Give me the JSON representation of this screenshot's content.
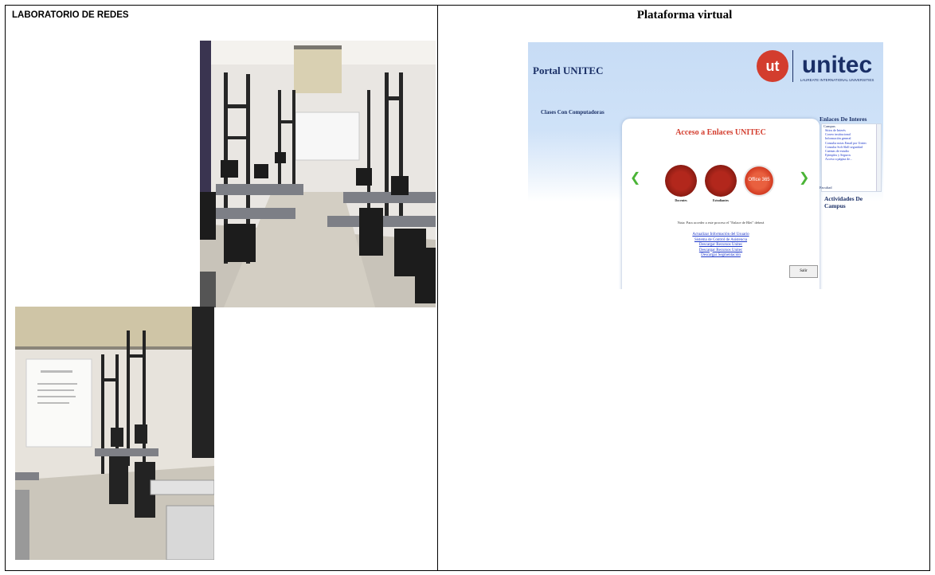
{
  "left_column": {
    "heading": "LABORATORIO DE REDES"
  },
  "right_column": {
    "heading": "Plataforma virtual"
  },
  "portal": {
    "title": "Portal UNITEC",
    "brand": "unitec",
    "brand_subtitle": "LAUREATE INTERNATIONAL UNIVERSITIES",
    "logo_letters": "ut",
    "clases_label": "Clases Con Computadoras",
    "enlaces_heading": "Enlaces De Interes",
    "card_title": "Acceso a Enlaces UNITEC",
    "icon_labels": [
      "Docentes",
      "Estudiantes",
      "Office 365"
    ],
    "note": "Nota: Para acceder a este proceso el \"Enlace de Blei\" deberá",
    "links": [
      "Actualizar Información del Usuario",
      "Sistema de Control de Asistencia",
      "Descargar Recursos Unitec",
      "Descargar Recursos Unitec",
      "Descargar Segmentación"
    ],
    "salir_label": "Salir",
    "sidebar_category": "Campus",
    "sidebar_links": [
      "Sitios de Interés",
      "Correo institucional",
      "Información general",
      "Consulta notas Email por Unitec",
      "Consulta Soft Skill seguridad",
      "Cuentas de estudio",
      "Ejemplos y Seguros",
      "Acceso a página de..."
    ],
    "faculty_label": "Facultad",
    "actividades_label": "Actividades De Campus",
    "colors": {
      "accent_red": "#d33d2e",
      "navy": "#1a2f66",
      "link_blue": "#1a35c9",
      "arrow_green": "#4ab436"
    }
  },
  "photos": [
    {
      "name": "lab-photo-racks",
      "description_icon": "network-lab-photo"
    },
    {
      "name": "lab-photo-projector",
      "description_icon": "network-lab-photo"
    }
  ]
}
